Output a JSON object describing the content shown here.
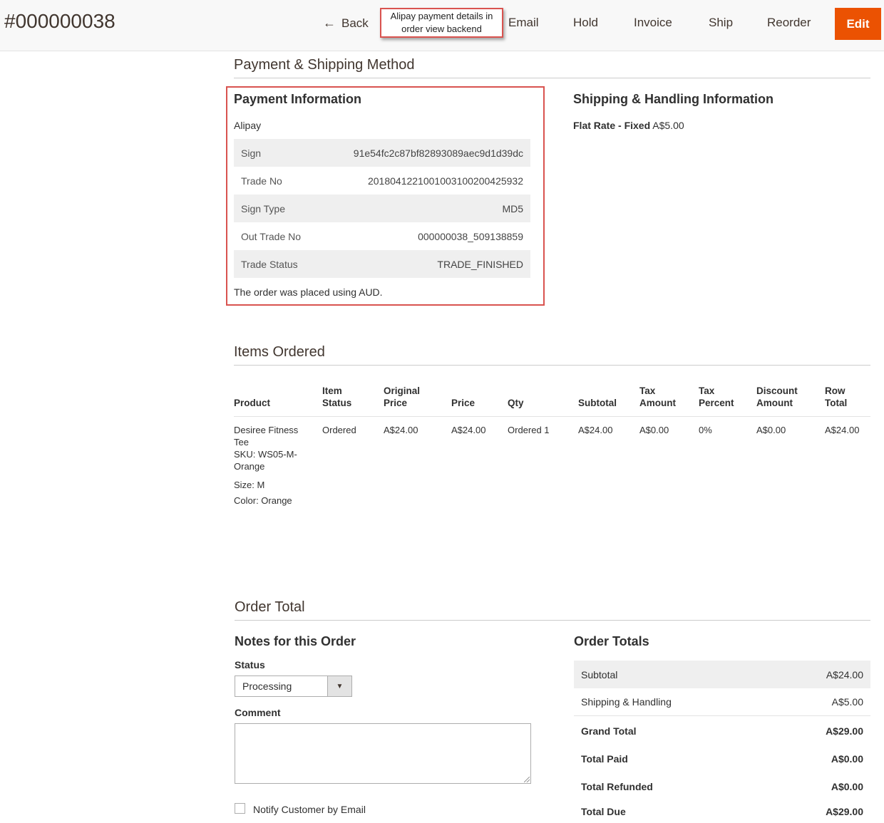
{
  "header": {
    "order_number": "#000000038",
    "back_label": "Back",
    "back_icon": "arrow-left-icon",
    "email_label": "Email",
    "hold_label": "Hold",
    "invoice_label": "Invoice",
    "ship_label": "Ship",
    "reorder_label": "Reorder",
    "edit_label": "Edit",
    "accent_color": "#eb5202"
  },
  "callout": {
    "line1": "Alipay payment details in",
    "line2": "order view backend",
    "border_color": "#d9534f"
  },
  "payment_shipping": {
    "section_title": "Payment & Shipping Method",
    "payment_title": "Payment Information",
    "method_name": "Alipay",
    "details": [
      {
        "label": "Sign",
        "value": "91e54fc2c87bf82893089aec9d1d39dc"
      },
      {
        "label": "Trade No",
        "value": "2018041221001003100200425932"
      },
      {
        "label": "Sign Type",
        "value": "MD5"
      },
      {
        "label": "Out Trade No",
        "value": "000000038_509138859"
      },
      {
        "label": "Trade Status",
        "value": "TRADE_FINISHED"
      }
    ],
    "currency_note": "The order was placed using AUD.",
    "shipping_title": "Shipping & Handling Information",
    "shipping_method": "Flat Rate - Fixed",
    "shipping_price": "A$5.00"
  },
  "items": {
    "section_title": "Items Ordered",
    "columns": {
      "product": "Product",
      "item_status_1": "Item",
      "item_status_2": "Status",
      "original_price_1": "Original",
      "original_price_2": "Price",
      "price": "Price",
      "qty": "Qty",
      "subtotal": "Subtotal",
      "tax_amount_1": "Tax",
      "tax_amount_2": "Amount",
      "tax_percent_1": "Tax",
      "tax_percent_2": "Percent",
      "discount_1": "Discount",
      "discount_2": "Amount",
      "row_total_1": "Row",
      "row_total_2": "Total"
    },
    "rows": [
      {
        "product_line1": "Desiree Fitness",
        "product_line2": "Tee",
        "sku_line1": "SKU: WS05-M-",
        "sku_line2": "Orange",
        "size": "Size: M",
        "color": "Color: Orange",
        "status": "Ordered",
        "original_price": "A$24.00",
        "price": "A$24.00",
        "qty": "Ordered 1",
        "subtotal": "A$24.00",
        "tax_amount": "A$0.00",
        "tax_percent": "0%",
        "discount": "A$0.00",
        "row_total": "A$24.00"
      }
    ]
  },
  "order_total": {
    "section_title": "Order Total",
    "notes_title": "Notes for this Order",
    "status_label": "Status",
    "status_value": "Processing",
    "comment_label": "Comment",
    "notify_label": "Notify Customer by Email",
    "totals_title": "Order Totals",
    "totals": [
      {
        "label": "Subtotal",
        "value": "A$24.00"
      },
      {
        "label": "Shipping & Handling",
        "value": "A$5.00"
      },
      {
        "label": "Grand Total",
        "value": "A$29.00"
      },
      {
        "label": "Total Paid",
        "value": "A$0.00"
      },
      {
        "label": "Total Refunded",
        "value": "A$0.00"
      },
      {
        "label": "Total Due",
        "value": "A$29.00"
      }
    ]
  }
}
